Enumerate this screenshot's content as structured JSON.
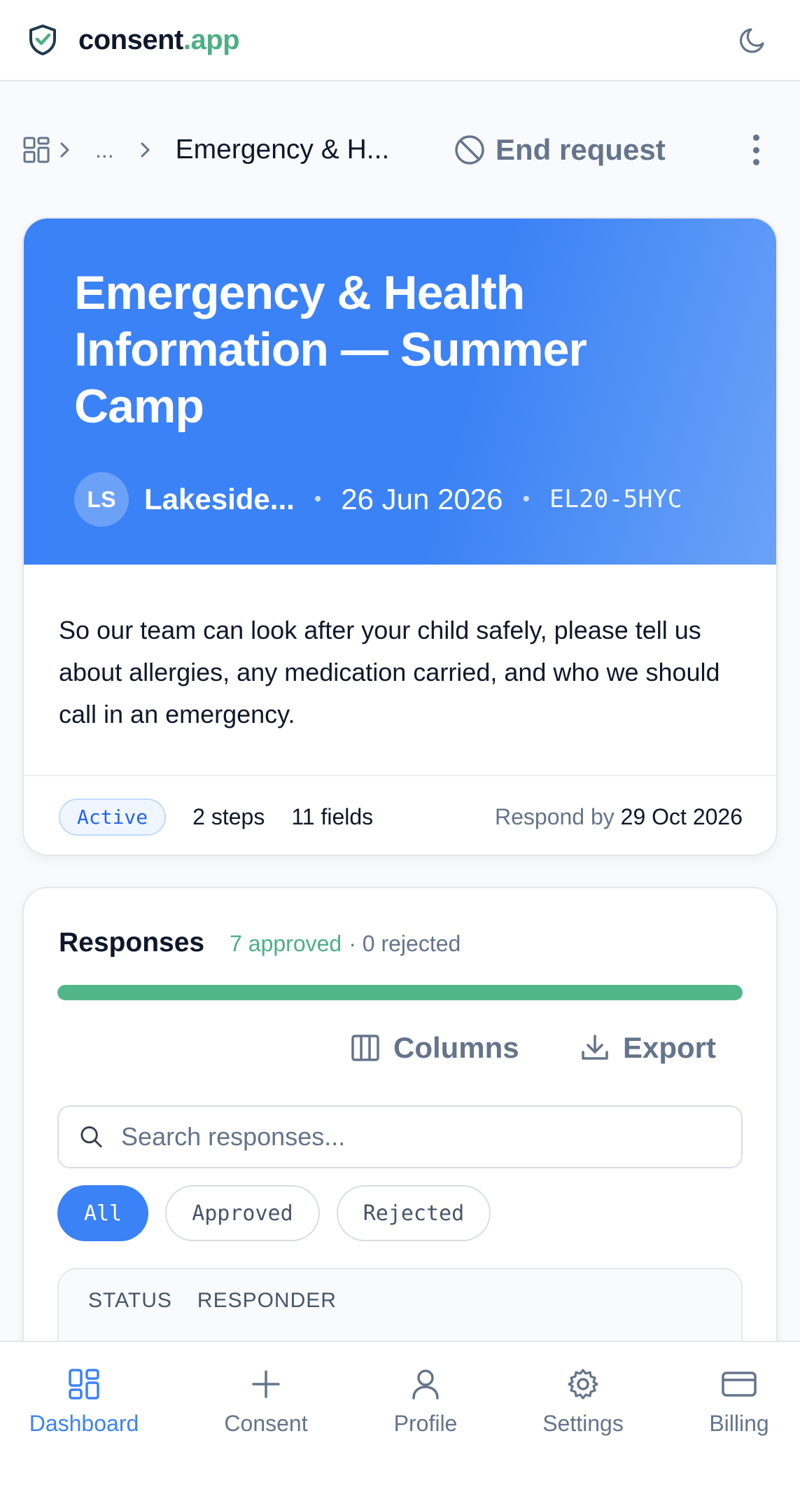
{
  "app": {
    "brand_main": "consent",
    "brand_tld": ".app"
  },
  "breadcrumb": {
    "ellipsis": "...",
    "current": "Emergency & H...",
    "end_request_label": "End request"
  },
  "request": {
    "title": "Emergency & Health Information — Summer Camp",
    "avatar_initials": "LS",
    "organization": "Lakeside...",
    "date": "26 Jun 2026",
    "code": "EL20-5HYC",
    "description": "So our team can look after your child safely, please tell us about allergies, any medication carried, and who we should call in an emergency.",
    "status": "Active",
    "steps": "2 steps",
    "fields": "11 fields",
    "respond_by_label": "Respond by",
    "respond_by_date": "29 Oct 2026"
  },
  "responses": {
    "title": "Responses",
    "approved_text": "7 approved",
    "rejected_text": "· 0 rejected",
    "approved_fraction": 1.0,
    "columns_label": "Columns",
    "export_label": "Export",
    "search_placeholder": "Search responses...",
    "filters": [
      "All",
      "Approved",
      "Rejected"
    ],
    "active_filter": "All",
    "table_headers": [
      "STATUS",
      "RESPONDER"
    ]
  },
  "nav": {
    "items": [
      "Dashboard",
      "Consent",
      "Profile",
      "Settings",
      "Billing"
    ],
    "active": "Dashboard"
  },
  "colors": {
    "accent": "#3b82f6",
    "success": "#52b788",
    "muted": "#64748b"
  }
}
